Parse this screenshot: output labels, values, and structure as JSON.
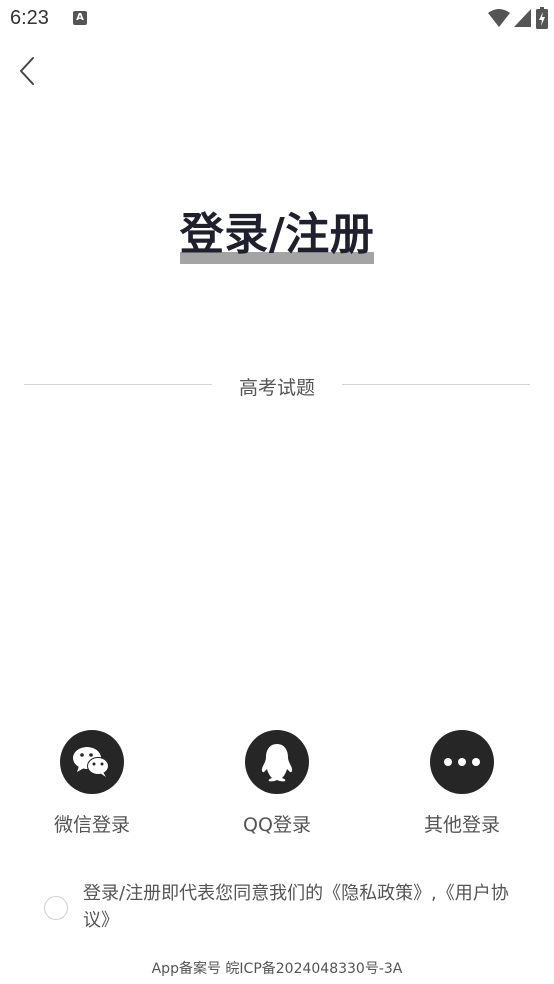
{
  "status_bar": {
    "time": "6:23",
    "notification_icon": "A"
  },
  "back_icon": "chevron-left-icon",
  "title": "登录/注册",
  "divider_label": "高考试题",
  "login_options": [
    {
      "label": "微信登录",
      "icon": "wechat-icon"
    },
    {
      "label": "QQ登录",
      "icon": "qq-icon"
    },
    {
      "label": "其他登录",
      "icon": "more-dots-icon"
    }
  ],
  "agreement_text": "登录/注册即代表您同意我们的《隐私政策》,《用户协议》",
  "footer": "App备案号 皖ICP备2024048330号-3A",
  "colors": {
    "icon_bg": "#262626",
    "title": "#1f1f2e",
    "title_highlight": "#a4a4a4"
  }
}
